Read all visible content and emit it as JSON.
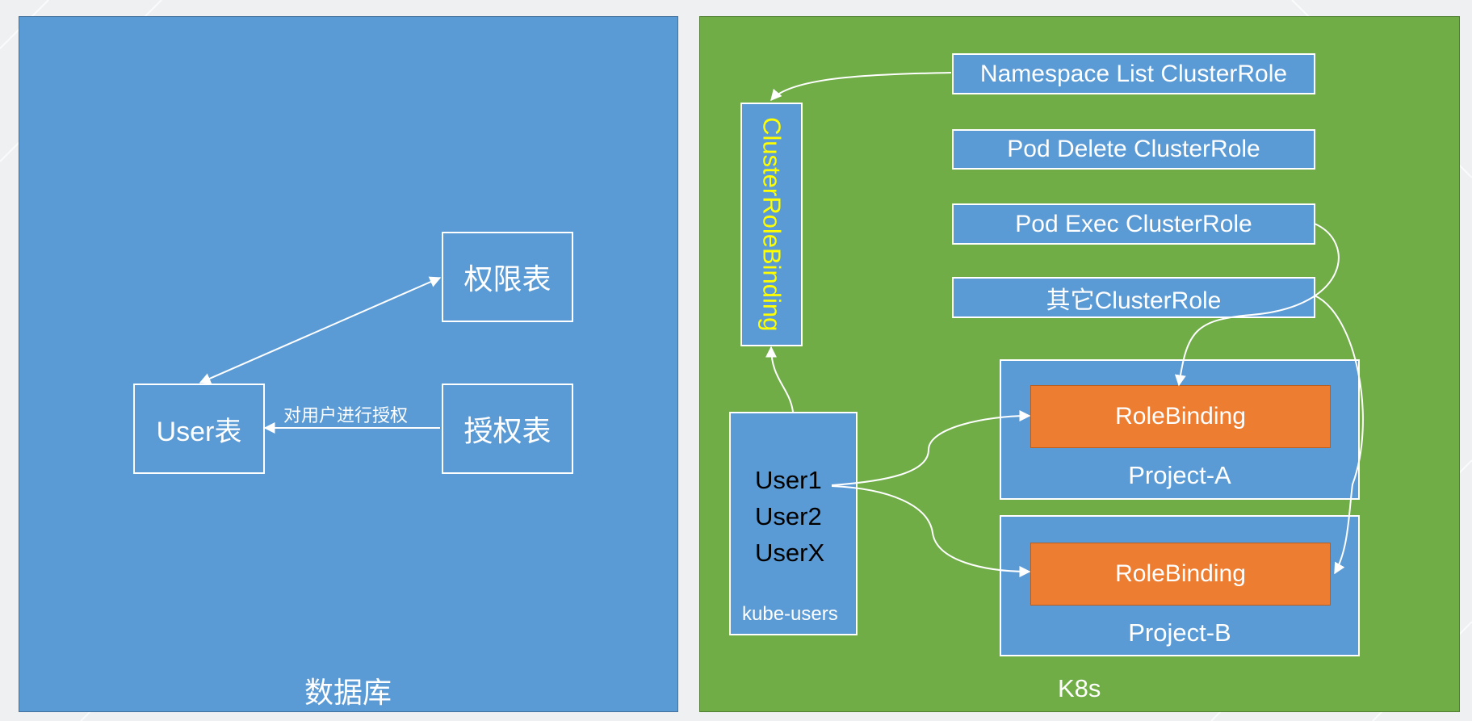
{
  "database": {
    "title": "数据库",
    "permission_table": "权限表",
    "auth_table": "授权表",
    "user_table": "User表",
    "arrow_label": "对用户进行授权"
  },
  "k8s": {
    "title": "K8s",
    "cluster_role_binding": "ClusterRoleBinding",
    "cluster_roles": [
      "Namespace List ClusterRole",
      "Pod Delete ClusterRole",
      "Pod Exec ClusterRole",
      "其它ClusterRole"
    ],
    "users": [
      "User1",
      "User2",
      "UserX"
    ],
    "users_group": "kube-users",
    "projects": [
      {
        "binding": "RoleBinding",
        "name": "Project-A"
      },
      {
        "binding": "RoleBinding",
        "name": "Project-B"
      }
    ]
  },
  "colors": {
    "db_panel": "#5b9bd5",
    "k8s_panel": "#70ad47",
    "role_binding": "#ed7d31",
    "cluster_role_binding_text": "#ffff00"
  }
}
